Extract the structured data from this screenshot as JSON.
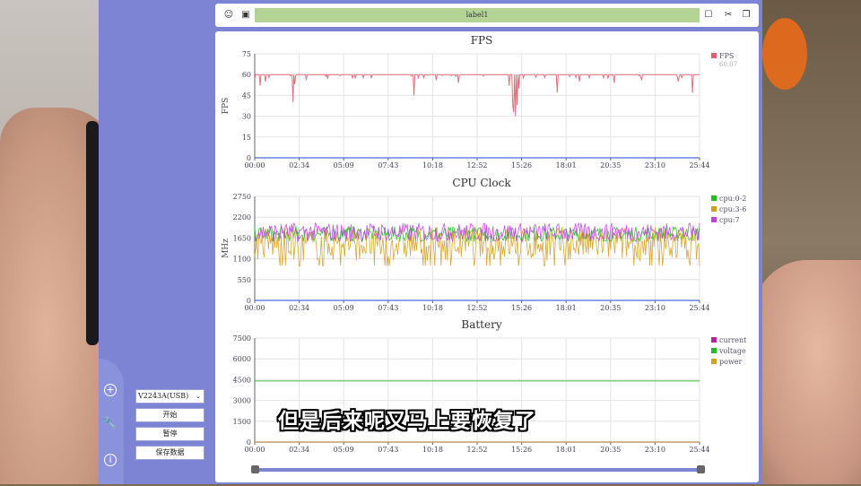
{
  "toolbar": {
    "label": "label1",
    "left_icons": [
      "user-icon",
      "image-icon"
    ],
    "right_icons": [
      "bookmark-icon",
      "scissors-icon",
      "folder-icon"
    ]
  },
  "sidebar": {
    "icons": [
      "plus-circle-icon",
      "wrench-icon",
      "info-icon"
    ]
  },
  "controls": {
    "device": "V2243A(USB)",
    "start": "开始",
    "pause": "暂停",
    "save": "保存数据"
  },
  "subtitle": "但是后来呢又马上要恢复了",
  "chart_data": [
    {
      "type": "line",
      "title": "FPS",
      "ylabel": "FPS",
      "ylim": [
        0,
        75
      ],
      "yticks": [
        0,
        15,
        30,
        45,
        60,
        75
      ],
      "xticks": [
        "00:00",
        "02:34",
        "05:09",
        "07:43",
        "10:18",
        "12:52",
        "15:26",
        "18:01",
        "20:35",
        "23:10",
        "25:44"
      ],
      "grid": true,
      "legend_position": "top-right",
      "series": [
        {
          "name": "FPS",
          "value_label": "60.07",
          "color": "#e06070",
          "baseline": 60,
          "dips": [
            [
              0.3,
              52
            ],
            [
              0.6,
              55
            ],
            [
              2.2,
              40
            ],
            [
              2.3,
              53
            ],
            [
              3.0,
              56
            ],
            [
              4.2,
              57
            ],
            [
              9.2,
              45
            ],
            [
              10.5,
              56
            ],
            [
              11.8,
              54
            ],
            [
              14.7,
              52
            ],
            [
              14.9,
              38
            ],
            [
              15.0,
              33
            ],
            [
              15.1,
              30
            ],
            [
              15.2,
              38
            ],
            [
              15.3,
              50
            ],
            [
              17.5,
              47
            ],
            [
              18.8,
              55
            ],
            [
              20.8,
              54
            ],
            [
              22.4,
              56
            ],
            [
              24.5,
              55
            ],
            [
              25.3,
              47
            ]
          ]
        }
      ]
    },
    {
      "type": "line",
      "title": "CPU Clock",
      "ylabel": "MHz",
      "ylim": [
        0,
        2750
      ],
      "yticks": [
        0,
        550,
        1100,
        1650,
        2200,
        2750
      ],
      "xticks": [
        "00:00",
        "02:34",
        "05:09",
        "07:43",
        "10:18",
        "12:52",
        "15:26",
        "18:01",
        "20:35",
        "23:10",
        "25:44"
      ],
      "grid": true,
      "legend_position": "top-right",
      "series": [
        {
          "name": "cpu:0-2",
          "color": "#22bb22",
          "mean": 1750,
          "amp": 200
        },
        {
          "name": "cpu:3-6",
          "color": "#d4a020",
          "mean": 1500,
          "amp": 450
        },
        {
          "name": "cpu:7",
          "color": "#bb44dd",
          "mean": 1800,
          "amp": 250
        }
      ]
    },
    {
      "type": "line",
      "title": "Battery",
      "ylabel": "",
      "ylim": [
        0,
        7500
      ],
      "yticks": [
        0,
        1500,
        3000,
        4500,
        6000,
        7500
      ],
      "xticks": [
        "00:00",
        "02:34",
        "05:09",
        "07:43",
        "10:18",
        "12:52",
        "15:26",
        "18:01",
        "20:35",
        "23:10",
        "25:44"
      ],
      "grid": true,
      "legend_position": "top-right",
      "series": [
        {
          "name": "current",
          "color": "#bb2299",
          "values": [
            0,
            0
          ]
        },
        {
          "name": "voltage",
          "color": "#22bb22",
          "values": [
            4400,
            4400
          ]
        },
        {
          "name": "power",
          "color": "#d4a020",
          "values": [
            0,
            0
          ]
        }
      ]
    }
  ]
}
